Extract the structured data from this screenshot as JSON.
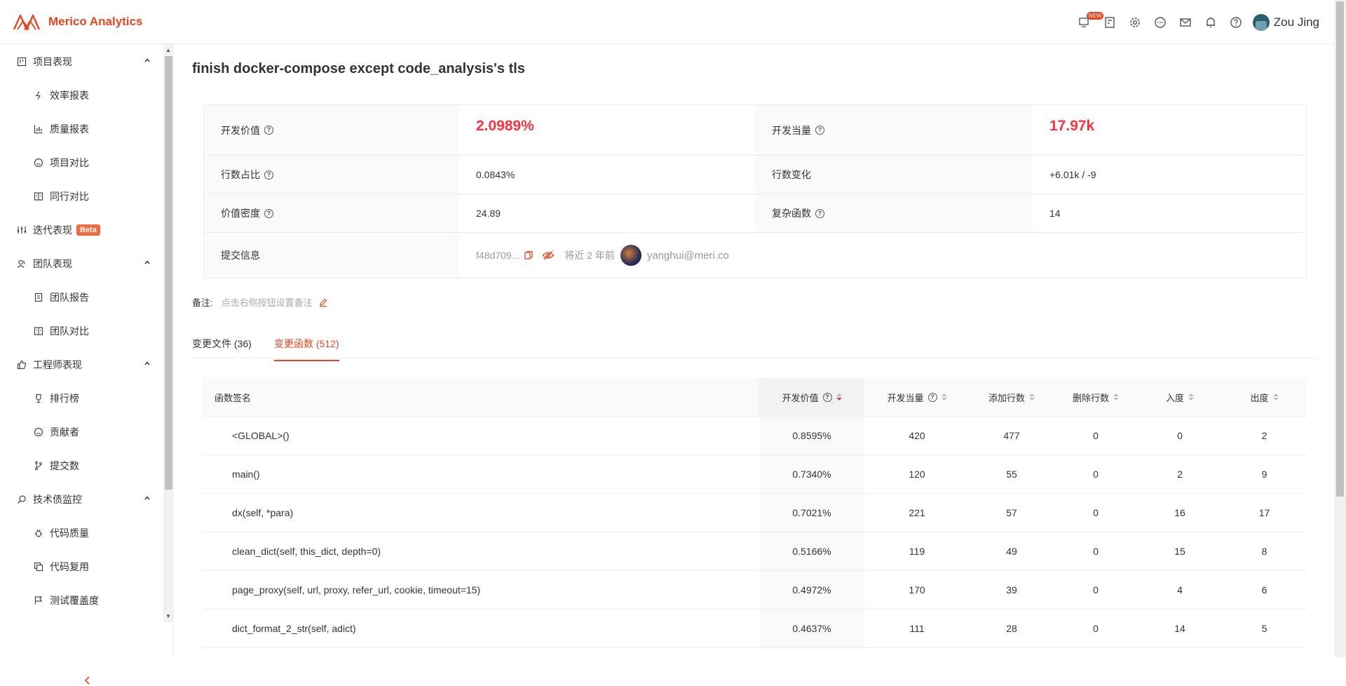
{
  "app": {
    "name": "Merico Analytics",
    "brand_color": "#e5461f"
  },
  "header": {
    "new_badge": "NEW",
    "icons": [
      "screen-new-icon",
      "dashboard-icon",
      "gear-icon",
      "chat-icon",
      "mail-icon",
      "bell-icon",
      "help-icon"
    ],
    "user_name": "Zou Jing"
  },
  "sidebar": {
    "items": [
      {
        "label": "项目表现",
        "level": 1,
        "icon": "board-icon",
        "caret": "up"
      },
      {
        "label": "效率报表",
        "level": 2,
        "icon": "bolt-icon"
      },
      {
        "label": "质量报表",
        "level": 2,
        "icon": "bar-chart-icon"
      },
      {
        "label": "项目对比",
        "level": 2,
        "icon": "smile-icon"
      },
      {
        "label": "同行对比",
        "level": 2,
        "icon": "compare-icon"
      },
      {
        "label": "迭代表现",
        "level": 1,
        "icon": "sliders-icon",
        "badge": "Beta"
      },
      {
        "label": "团队表现",
        "level": 1,
        "icon": "team-icon",
        "caret": "up"
      },
      {
        "label": "团队报告",
        "level": 2,
        "icon": "report-icon"
      },
      {
        "label": "团队对比",
        "level": 2,
        "icon": "compare-icon"
      },
      {
        "label": "工程师表现",
        "level": 1,
        "icon": "thumb-up-icon",
        "caret": "up"
      },
      {
        "label": "排行榜",
        "level": 2,
        "icon": "trophy-icon"
      },
      {
        "label": "贡献者",
        "level": 2,
        "icon": "smile-icon"
      },
      {
        "label": "提交数",
        "level": 2,
        "icon": "branch-icon"
      },
      {
        "label": "技术债监控",
        "level": 1,
        "icon": "search-icon",
        "caret": "up"
      },
      {
        "label": "代码质量",
        "level": 2,
        "icon": "bug-icon"
      },
      {
        "label": "代码复用",
        "level": 2,
        "icon": "copy-icon"
      },
      {
        "label": "测试覆盖度",
        "level": 2,
        "icon": "flag-icon"
      }
    ]
  },
  "main": {
    "title": "finish docker-compose except code_analysis's tls",
    "info": {
      "dev_value_label": "开发价值",
      "dev_value": "2.0989%",
      "dev_equiv_label": "开发当量",
      "dev_equiv": "17.97k",
      "line_ratio_label": "行数占比",
      "line_ratio": "0.0843%",
      "line_change_label": "行数变化",
      "line_change": "+6.01k / -9",
      "value_density_label": "价值密度",
      "value_density": "24.89",
      "complex_func_label": "复杂函数",
      "complex_func": "14",
      "commit_info_label": "提交信息",
      "commit_hash": "f48d709...",
      "commit_time": "将近 2 年前",
      "commit_author": "yanghui@meri.co"
    },
    "note": {
      "label": "备注:",
      "placeholder": "点击右侧按钮设置备注"
    },
    "tabs": [
      {
        "label": "变更文件 (36)",
        "active": false
      },
      {
        "label": "变更函数 (512)",
        "active": true
      }
    ],
    "table": {
      "headers": [
        "函数签名",
        "开发价值",
        "开发当量",
        "添加行数",
        "删除行数",
        "入度",
        "出度"
      ],
      "rows": [
        [
          "<GLOBAL>()",
          "0.8595%",
          "420",
          "477",
          "0",
          "0",
          "2"
        ],
        [
          "main()",
          "0.7340%",
          "120",
          "55",
          "0",
          "2",
          "9"
        ],
        [
          "dx(self, *para)",
          "0.7021%",
          "221",
          "57",
          "0",
          "16",
          "17"
        ],
        [
          "clean_dict(self, this_dict, depth=0)",
          "0.5166%",
          "119",
          "49",
          "0",
          "15",
          "8"
        ],
        [
          "page_proxy(self, url, proxy, refer_url, cookie, timeout=15)",
          "0.4972%",
          "170",
          "39",
          "0",
          "4",
          "6"
        ],
        [
          "dict_format_2_str(self, adict)",
          "0.4637%",
          "111",
          "28",
          "0",
          "14",
          "5"
        ]
      ]
    }
  }
}
